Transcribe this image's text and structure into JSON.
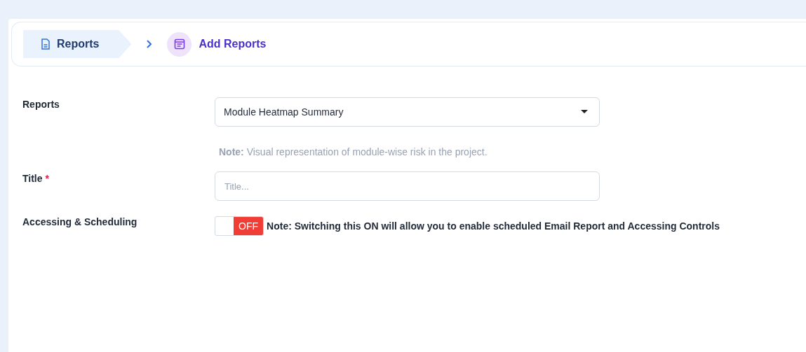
{
  "breadcrumb": [
    {
      "label": "Reports",
      "selected": false
    },
    {
      "label": "Add Reports",
      "selected": true
    }
  ],
  "form": {
    "fields": [
      {
        "kind": "select",
        "label": "Reports",
        "value": "Module Heatmap Summary",
        "note": "**Note:** Visual representation of module-wise risk in the project."
      },
      {
        "kind": "text",
        "label": "Title",
        "required_mark": "*",
        "placeholder": "Title..."
      },
      {
        "kind": "toggle",
        "label": "Accessing & Scheduling",
        "on": false,
        "state_label": "OFF",
        "note": "Note: Switching this ON will allow you to enable scheduled Email Report and Accessing Controls"
      }
    ]
  }
}
